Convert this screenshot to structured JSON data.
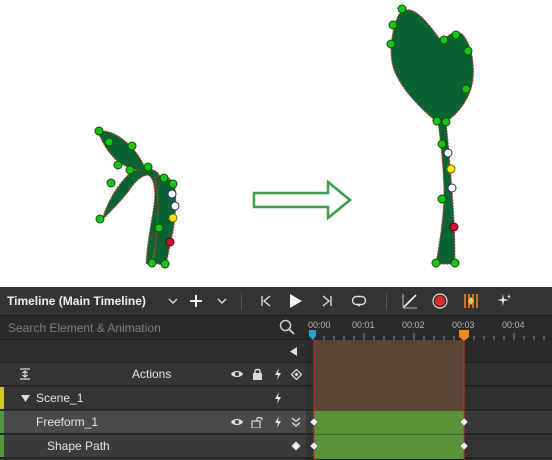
{
  "timeline": {
    "title": "Timeline (Main Timeline)",
    "search_placeholder": "Search Element & Animation",
    "rows": {
      "actions": "Actions",
      "scene": "Scene_1",
      "freeform": "Freeform_1",
      "shape_path": "Shape Path"
    },
    "ruler_labels": [
      "00:00",
      "00:01",
      "00:02",
      "00:03",
      "00:04"
    ],
    "icons": {
      "toolbar": [
        "chevron-down-icon",
        "plus-icon",
        "chevron-down-icon",
        "skip-to-start-icon",
        "play-icon",
        "skip-to-end-icon",
        "loop-icon",
        "easing-curve-icon",
        "record-icon",
        "auto-keyframe-icon",
        "magic-sparkle-icon"
      ],
      "row": [
        "eye-icon",
        "lock-icon",
        "lightning-icon",
        "keyframe-diamond-icon",
        "expand-icon",
        "collapse-triangle-icon"
      ]
    }
  },
  "colors": {
    "plant_fill": "#0a6332",
    "plant_outline": "#c0392b",
    "arrow_fill": "#ffffff",
    "arrow_stroke": "#3a9a4e",
    "point_green": "#18c418",
    "point_yellow": "#f3e41a",
    "point_red": "#d01030",
    "point_white": "#ffffff",
    "playhead_start": "#2a9fd6",
    "playhead_end": "#f08a1c",
    "timeline_bg": "#2b2b2b",
    "track_brown": "#5b4636",
    "track_green": "#58923a",
    "scene_marker": "#d6c22a",
    "element_marker": "#4e9b3a",
    "record_red": "#e02c2c"
  }
}
